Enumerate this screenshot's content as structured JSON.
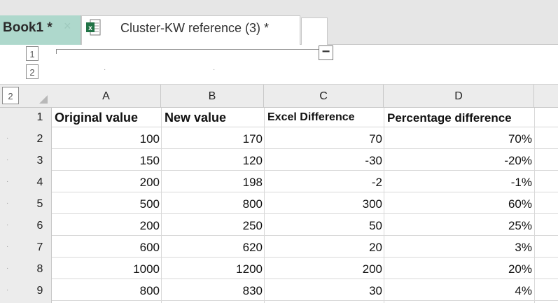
{
  "tabs": [
    {
      "label": "Book1 *",
      "close": "×"
    },
    {
      "label": "Cluster-KW reference (3) *"
    }
  ],
  "outline": {
    "level1": "1",
    "level2": "2",
    "side_level": "2",
    "collapse": "−"
  },
  "columns": [
    "A",
    "B",
    "C",
    "D"
  ],
  "rows": [
    {
      "n": "1",
      "cells": [
        "Original value",
        "New value",
        "Excel Difference",
        "Percentage difference"
      ]
    },
    {
      "n": "2",
      "cells": [
        "100",
        "170",
        "70",
        "70%"
      ]
    },
    {
      "n": "3",
      "cells": [
        "150",
        "120",
        "-30",
        "-20%"
      ]
    },
    {
      "n": "4",
      "cells": [
        "200",
        "198",
        "-2",
        "-1%"
      ]
    },
    {
      "n": "5",
      "cells": [
        "500",
        "800",
        "300",
        "60%"
      ]
    },
    {
      "n": "6",
      "cells": [
        "200",
        "250",
        "50",
        "25%"
      ]
    },
    {
      "n": "7",
      "cells": [
        "600",
        "620",
        "20",
        "3%"
      ]
    },
    {
      "n": "8",
      "cells": [
        "1000",
        "1200",
        "200",
        "20%"
      ]
    },
    {
      "n": "9",
      "cells": [
        "800",
        "830",
        "30",
        "4%"
      ]
    }
  ],
  "colors": {
    "active_tab": "#aed8cc",
    "header_bg": "#ececec",
    "xls_icon": "#217346"
  }
}
